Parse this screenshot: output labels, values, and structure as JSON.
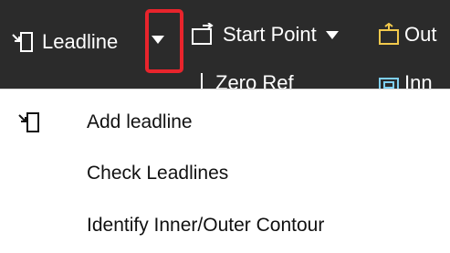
{
  "toolbar": {
    "leadline_label": "Leadline",
    "start_point_label": "Start Point",
    "outer_label": "Out",
    "zero_ref_label": "Zero Ref",
    "inner_label": "Inn",
    "icons": {
      "leadline": "leadline-icon",
      "start_point": "start-point-icon",
      "outer": "outer-contour-icon",
      "zero_ref": "zero-ref-icon",
      "inner": "inner-contour-icon"
    },
    "highlight_color": "#e8242c",
    "background_color": "#2b2b2b"
  },
  "menu": {
    "items": [
      {
        "label": "Add leadline",
        "icon": "leadline-icon"
      },
      {
        "label": "Check Leadlines"
      },
      {
        "label": "Identify Inner/Outer Contour"
      }
    ]
  }
}
